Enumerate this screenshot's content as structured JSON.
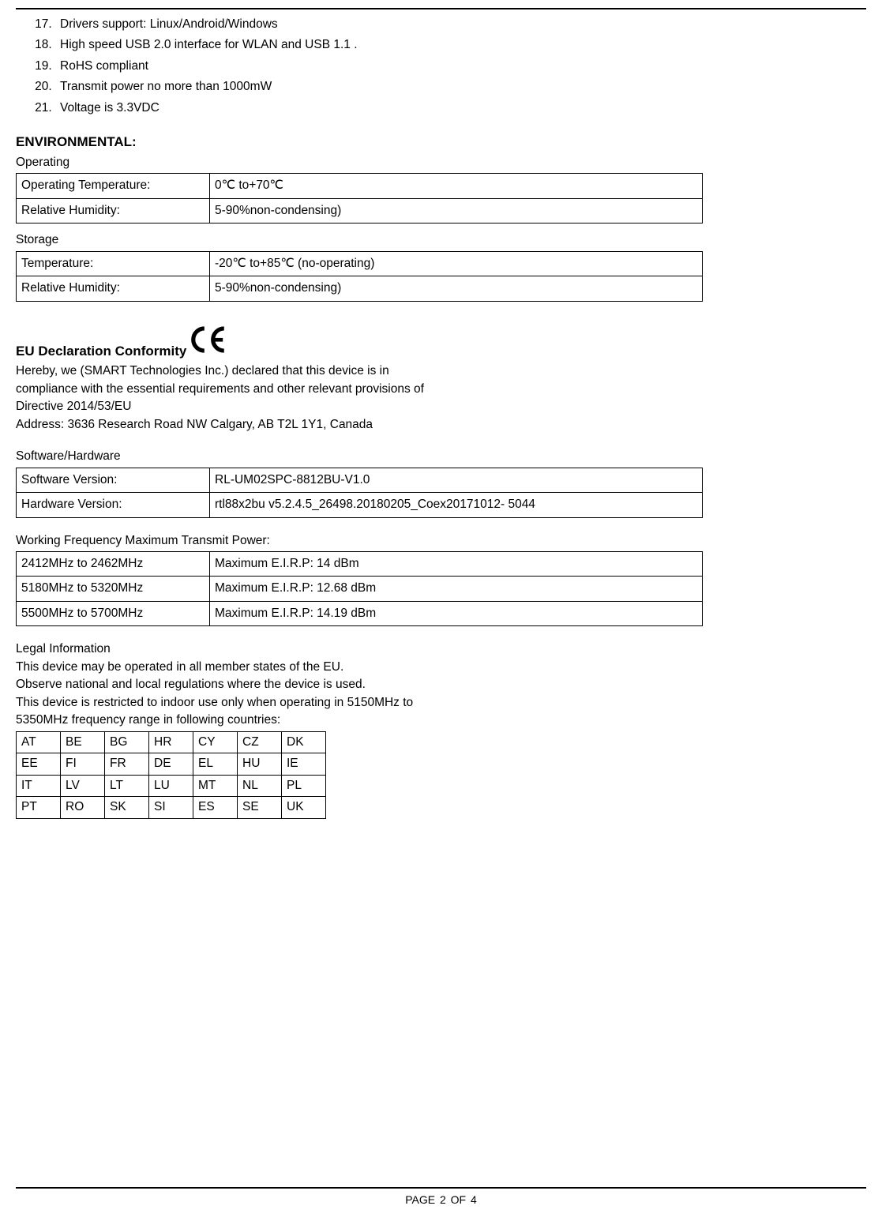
{
  "list": {
    "start": 17,
    "items": [
      "Drivers support: Linux/Android/Windows",
      "High speed USB 2.0 interface for WLAN and USB 1.1 .",
      "RoHS compliant",
      "Transmit power no more than 1000mW",
      "Voltage is 3.3VDC"
    ]
  },
  "env": {
    "heading": "ENVIRONMENTAL:",
    "operating_label": "Operating",
    "operating_rows": [
      {
        "k": "Operating Temperature:",
        "v": "0℃ to+70℃"
      },
      {
        "k": "Relative Humidity:",
        "v": "5-90%non-condensing)"
      }
    ],
    "storage_label": "Storage",
    "storage_rows": [
      {
        "k": "Temperature:",
        "v": "-20℃ to+85℃ (no-operating)"
      },
      {
        "k": "Relative Humidity:",
        "v": "5-90%non-condensing)"
      }
    ]
  },
  "eu": {
    "heading": "EU Declaration Conformity",
    "lines": [
      "Hereby, we (SMART Technologies Inc.) declared that this device is in",
      "compliance with the essential requirements and other relevant provisions of",
      "Directive 2014/53/EU",
      "Address: 3636 Research Road NW Calgary, AB T2L 1Y1, Canada"
    ]
  },
  "swhw": {
    "label": "Software/Hardware",
    "rows": [
      {
        "k": "Software Version:",
        "v": "RL-UM02SPC-8812BU-V1.0"
      },
      {
        "k": "Hardware Version:",
        "v": "rtl88x2bu v5.2.4.5_26498.20180205_Coex20171012- 5044"
      }
    ]
  },
  "freq": {
    "label": "Working Frequency Maximum Transmit Power:",
    "rows": [
      {
        "k": "2412MHz to 2462MHz",
        "v": "Maximum E.I.R.P: 14 dBm"
      },
      {
        "k": "5180MHz to 5320MHz",
        "v": "Maximum E.I.R.P: 12.68 dBm"
      },
      {
        "k": "5500MHz to 5700MHz",
        "v": "Maximum E.I.R.P: 14.19 dBm"
      }
    ]
  },
  "legal": {
    "heading": "Legal Information",
    "lines": [
      "This device may be operated in all member states of the EU.",
      "Observe national and local regulations where the device is used.",
      "This device is restricted to indoor use only when operating in 5150MHz to",
      "5350MHz frequency range in following countries:"
    ]
  },
  "countries": [
    [
      "AT",
      "BE",
      "BG",
      "HR",
      "CY",
      "CZ",
      "DK"
    ],
    [
      "EE",
      "FI",
      "FR",
      "DE",
      "EL",
      "HU",
      "IE"
    ],
    [
      "IT",
      "LV",
      "LT",
      "LU",
      "MT",
      "NL",
      "PL"
    ],
    [
      "PT",
      "RO",
      "SK",
      "SI",
      "ES",
      "SE",
      "UK"
    ]
  ],
  "footer": "PAGE  2  OF  4"
}
